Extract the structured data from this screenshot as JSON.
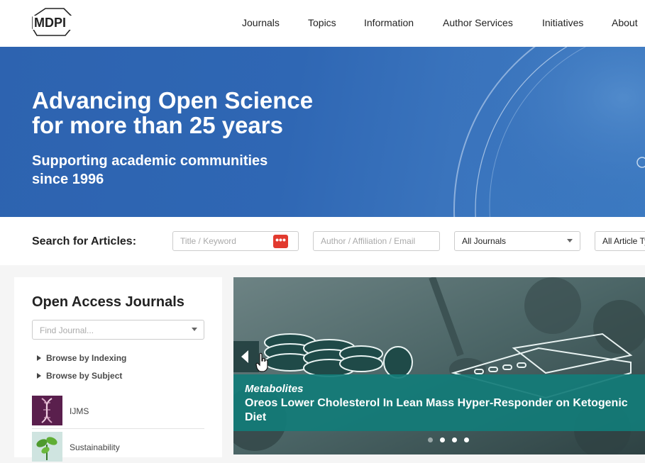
{
  "brand": {
    "logo_text": "MDPI"
  },
  "nav": {
    "items": [
      "Journals",
      "Topics",
      "Information",
      "Author Services",
      "Initiatives",
      "About"
    ]
  },
  "hero": {
    "title_line1": "Advancing Open Science",
    "title_line2": "for more than 25 years",
    "subtitle_line1": "Supporting academic communities",
    "subtitle_line2": "since 1996",
    "background_color": "#2f67b4"
  },
  "search": {
    "label": "Search for Articles:",
    "keyword_placeholder": "Title / Keyword",
    "author_placeholder": "Author / Affiliation / Email",
    "journal_select_value": "All Journals",
    "article_type_value": "All Article Types",
    "search_button_color": "#e23a2f"
  },
  "sidebar": {
    "title": "Open Access Journals",
    "find_placeholder": "Find Journal...",
    "browse_links": [
      "Browse by Indexing",
      "Browse by Subject"
    ],
    "journals": [
      {
        "name": "IJMS",
        "icon": "dna-icon",
        "color": "#5a1f4d"
      },
      {
        "name": "Sustainability",
        "icon": "plant-icon",
        "color": "#cfe4e0"
      }
    ]
  },
  "carousel": {
    "journal": "Metabolites",
    "title": "Oreos Lower Cholesterol In Lean Mass Hyper-Responder on Ketogenic Diet",
    "slide_count": 4,
    "active_slide": 1,
    "caption_color": "#127c78"
  }
}
